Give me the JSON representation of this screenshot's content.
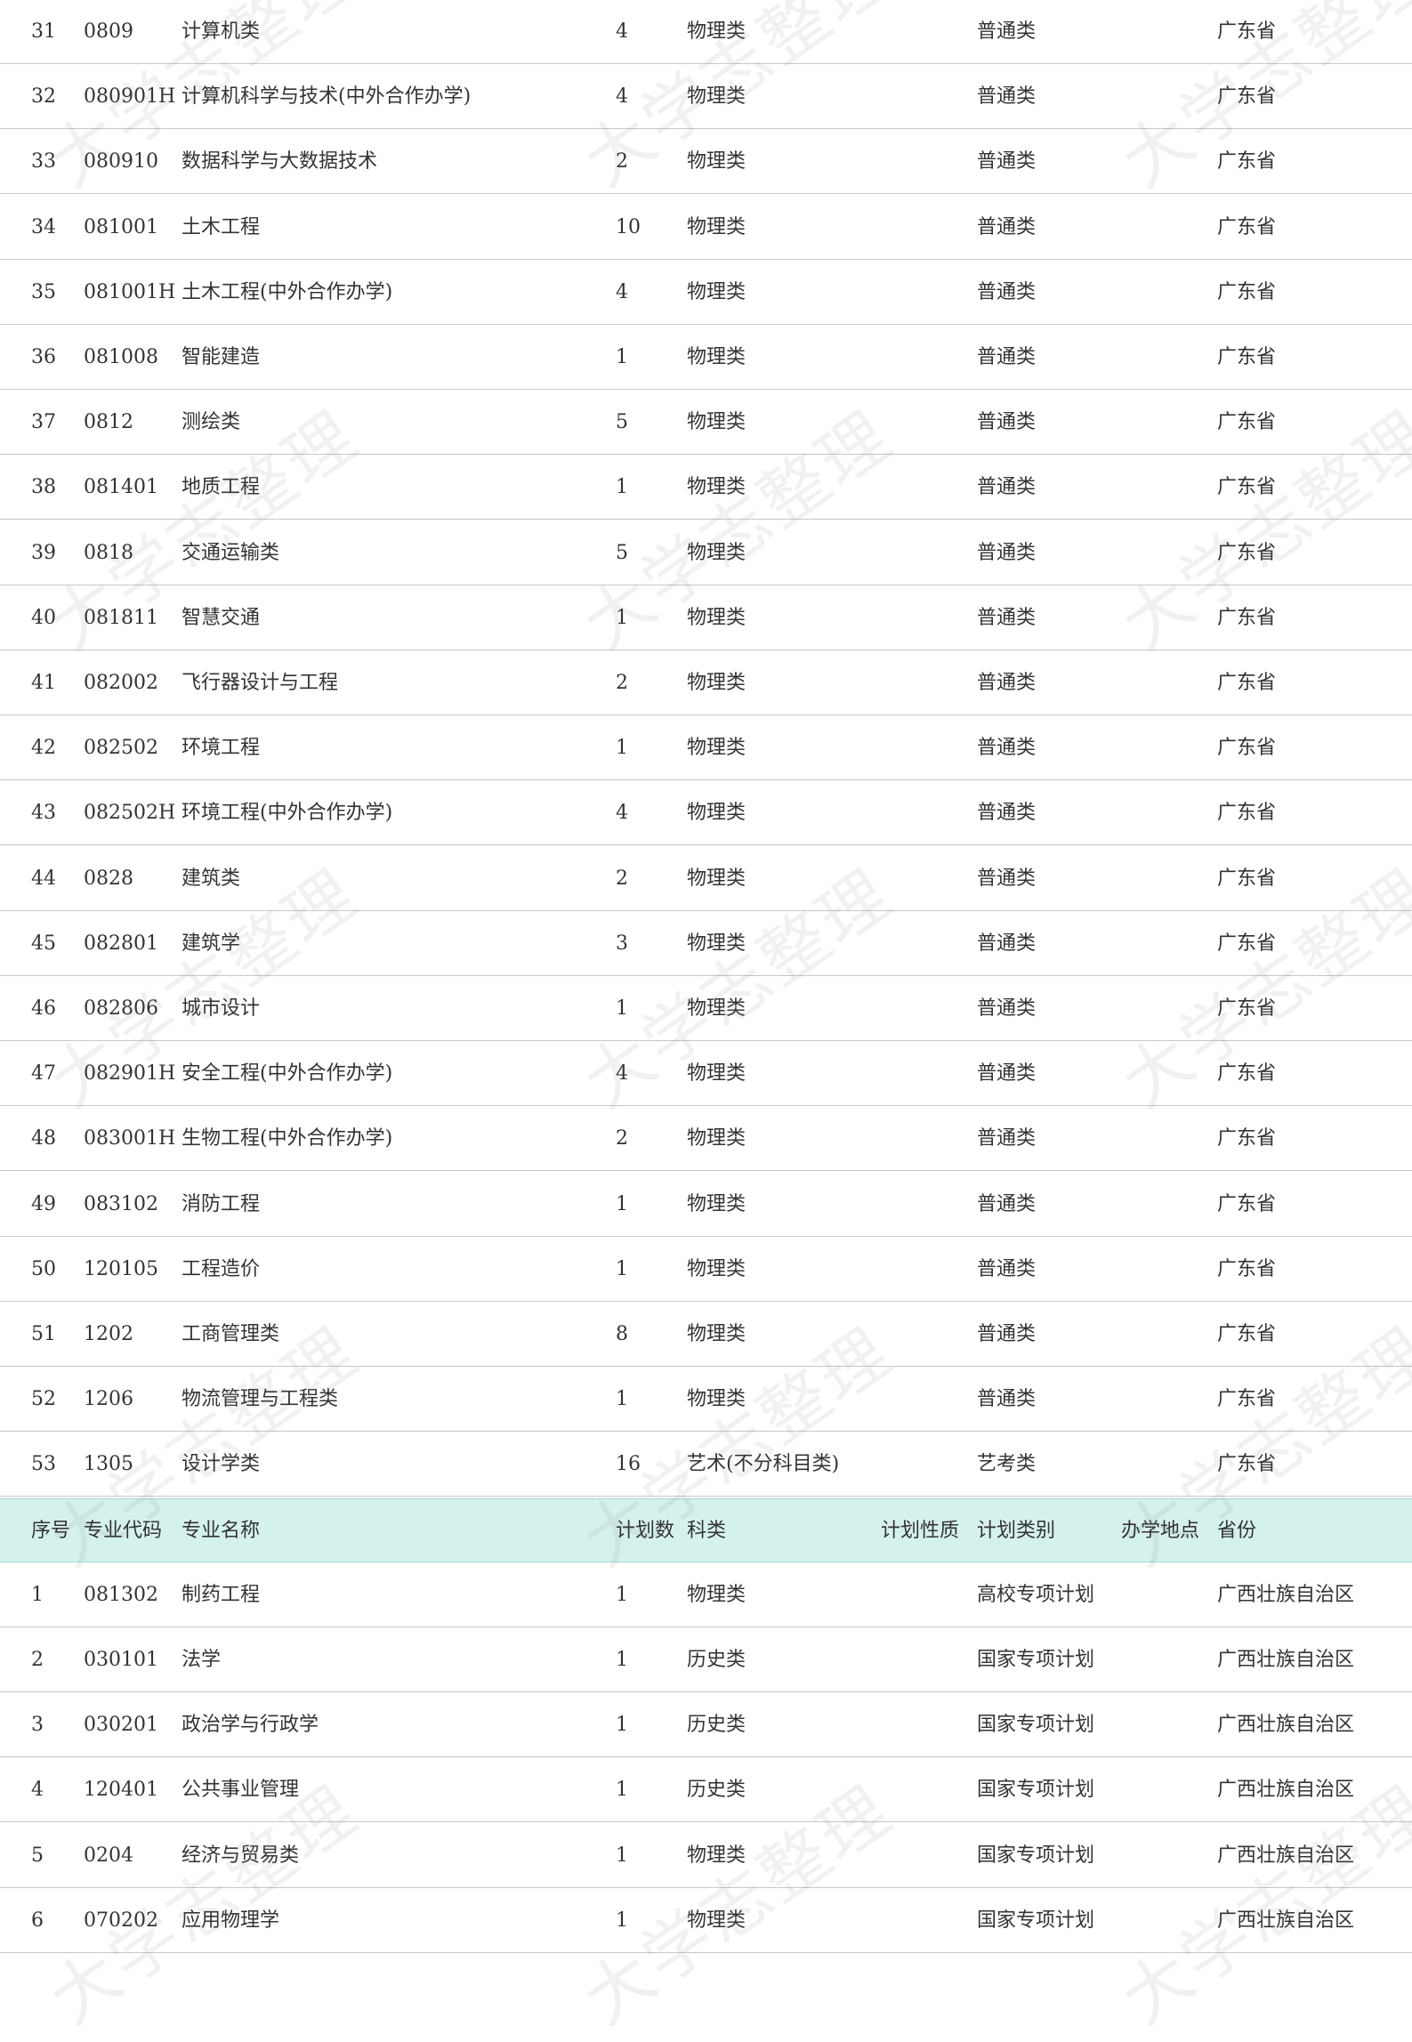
{
  "header": {
    "no": "序号",
    "code": "专业代码",
    "name": "专业名称",
    "plan": "计划数",
    "subject": "科类",
    "nature": "计划性质",
    "category": "计划类别",
    "location": "办学地点",
    "province": "省份"
  },
  "rows_top": [
    {
      "no": "31",
      "code": "0809",
      "name": "计算机类",
      "plan": "4",
      "subject": "物理类",
      "category": "普通类",
      "province": "广东省"
    },
    {
      "no": "32",
      "code": "080901H",
      "name": "计算机科学与技术(中外合作办学)",
      "plan": "4",
      "subject": "物理类",
      "category": "普通类",
      "province": "广东省"
    },
    {
      "no": "33",
      "code": "080910",
      "name": "数据科学与大数据技术",
      "plan": "2",
      "subject": "物理类",
      "category": "普通类",
      "province": "广东省"
    },
    {
      "no": "34",
      "code": "081001",
      "name": "土木工程",
      "plan": "10",
      "subject": "物理类",
      "category": "普通类",
      "province": "广东省"
    },
    {
      "no": "35",
      "code": "081001H",
      "name": "土木工程(中外合作办学)",
      "plan": "4",
      "subject": "物理类",
      "category": "普通类",
      "province": "广东省"
    },
    {
      "no": "36",
      "code": "081008",
      "name": "智能建造",
      "plan": "1",
      "subject": "物理类",
      "category": "普通类",
      "province": "广东省"
    },
    {
      "no": "37",
      "code": "0812",
      "name": "测绘类",
      "plan": "5",
      "subject": "物理类",
      "category": "普通类",
      "province": "广东省"
    },
    {
      "no": "38",
      "code": "081401",
      "name": "地质工程",
      "plan": "1",
      "subject": "物理类",
      "category": "普通类",
      "province": "广东省"
    },
    {
      "no": "39",
      "code": "0818",
      "name": "交通运输类",
      "plan": "5",
      "subject": "物理类",
      "category": "普通类",
      "province": "广东省"
    },
    {
      "no": "40",
      "code": "081811",
      "name": "智慧交通",
      "plan": "1",
      "subject": "物理类",
      "category": "普通类",
      "province": "广东省"
    },
    {
      "no": "41",
      "code": "082002",
      "name": "飞行器设计与工程",
      "plan": "2",
      "subject": "物理类",
      "category": "普通类",
      "province": "广东省"
    },
    {
      "no": "42",
      "code": "082502",
      "name": "环境工程",
      "plan": "1",
      "subject": "物理类",
      "category": "普通类",
      "province": "广东省"
    },
    {
      "no": "43",
      "code": "082502H",
      "name": "环境工程(中外合作办学)",
      "plan": "4",
      "subject": "物理类",
      "category": "普通类",
      "province": "广东省"
    },
    {
      "no": "44",
      "code": "0828",
      "name": "建筑类",
      "plan": "2",
      "subject": "物理类",
      "category": "普通类",
      "province": "广东省"
    },
    {
      "no": "45",
      "code": "082801",
      "name": "建筑学",
      "plan": "3",
      "subject": "物理类",
      "category": "普通类",
      "province": "广东省"
    },
    {
      "no": "46",
      "code": "082806",
      "name": "城市设计",
      "plan": "1",
      "subject": "物理类",
      "category": "普通类",
      "province": "广东省"
    },
    {
      "no": "47",
      "code": "082901H",
      "name": "安全工程(中外合作办学)",
      "plan": "4",
      "subject": "物理类",
      "category": "普通类",
      "province": "广东省"
    },
    {
      "no": "48",
      "code": "083001H",
      "name": "生物工程(中外合作办学)",
      "plan": "2",
      "subject": "物理类",
      "category": "普通类",
      "province": "广东省"
    },
    {
      "no": "49",
      "code": "083102",
      "name": "消防工程",
      "plan": "1",
      "subject": "物理类",
      "category": "普通类",
      "province": "广东省"
    },
    {
      "no": "50",
      "code": "120105",
      "name": "工程造价",
      "plan": "1",
      "subject": "物理类",
      "category": "普通类",
      "province": "广东省"
    },
    {
      "no": "51",
      "code": "1202",
      "name": "工商管理类",
      "plan": "8",
      "subject": "物理类",
      "category": "普通类",
      "province": "广东省"
    },
    {
      "no": "52",
      "code": "1206",
      "name": "物流管理与工程类",
      "plan": "1",
      "subject": "物理类",
      "category": "普通类",
      "province": "广东省"
    },
    {
      "no": "53",
      "code": "1305",
      "name": "设计学类",
      "plan": "16",
      "subject": "艺术(不分科目类)",
      "category": "艺考类",
      "province": "广东省"
    }
  ],
  "rows_bottom": [
    {
      "no": "1",
      "code": "081302",
      "name": "制药工程",
      "plan": "1",
      "subject": "物理类",
      "category": "高校专项计划",
      "province": "广西壮族自治区"
    },
    {
      "no": "2",
      "code": "030101",
      "name": "法学",
      "plan": "1",
      "subject": "历史类",
      "category": "国家专项计划",
      "province": "广西壮族自治区"
    },
    {
      "no": "3",
      "code": "030201",
      "name": "政治学与行政学",
      "plan": "1",
      "subject": "历史类",
      "category": "国家专项计划",
      "province": "广西壮族自治区"
    },
    {
      "no": "4",
      "code": "120401",
      "name": "公共事业管理",
      "plan": "1",
      "subject": "历史类",
      "category": "国家专项计划",
      "province": "广西壮族自治区"
    },
    {
      "no": "5",
      "code": "0204",
      "name": "经济与贸易类",
      "plan": "1",
      "subject": "物理类",
      "category": "国家专项计划",
      "province": "广西壮族自治区"
    },
    {
      "no": "6",
      "code": "070202",
      "name": "应用物理学",
      "plan": "1",
      "subject": "物理类",
      "category": "国家专项计划",
      "province": "广西壮族自治区"
    }
  ],
  "watermark": {
    "text": "大学志整理"
  }
}
